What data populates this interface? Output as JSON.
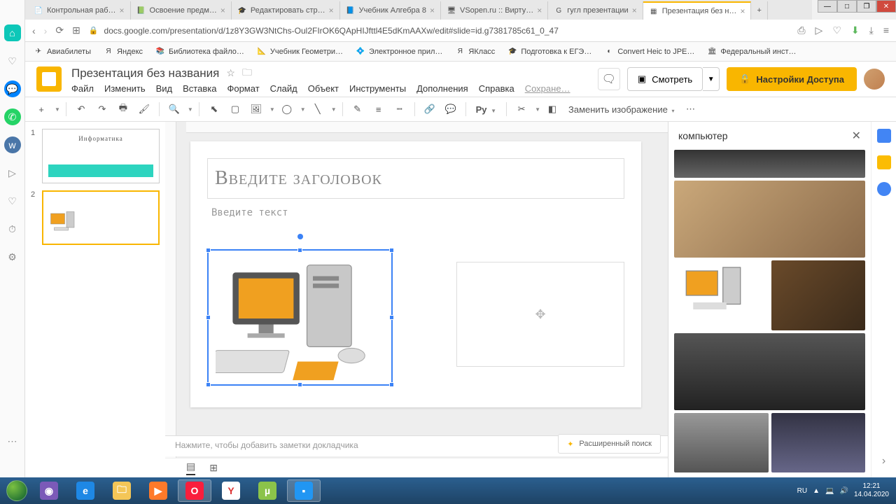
{
  "tabs": [
    {
      "title": "Контрольная раб…",
      "fav": "📄"
    },
    {
      "title": "Освоение предм…",
      "fav": "📗"
    },
    {
      "title": "Редактировать стр…",
      "fav": "🎓"
    },
    {
      "title": "Учебник Алгебра 8",
      "fav": "📘"
    },
    {
      "title": "VSopen.ru :: Вирту…",
      "fav": "🖥"
    },
    {
      "title": "гугл презентации",
      "fav": "G"
    },
    {
      "title": "Презентация без н…",
      "fav": "▦",
      "active": true
    }
  ],
  "url": "docs.google.com/presentation/d/1z8Y3GW3NtChs-Oul2FIrOK6QApHIJfttl4E5dKmAAXw/edit#slide=id.g7381785c61_0_47",
  "bookmarks": [
    {
      "label": "Авиабилеты",
      "icon": "✈"
    },
    {
      "label": "Яндекс",
      "icon": "Я"
    },
    {
      "label": "Библиотека файло…",
      "icon": "📚"
    },
    {
      "label": "Учебник Геометри…",
      "icon": "📐"
    },
    {
      "label": "Электронное прил…",
      "icon": "💠"
    },
    {
      "label": "ЯКласс",
      "icon": "Я"
    },
    {
      "label": "Подготовка к ЕГЭ…",
      "icon": "🎓"
    },
    {
      "label": "Convert Heic to JPE…",
      "icon": "◐"
    },
    {
      "label": "Федеральный инст…",
      "icon": "🏛"
    }
  ],
  "doc": {
    "title": "Презентация без названия",
    "saving": "Сохране…"
  },
  "menu": [
    "Файл",
    "Изменить",
    "Вид",
    "Вставка",
    "Формат",
    "Слайд",
    "Объект",
    "Инструменты",
    "Дополнения",
    "Справка"
  ],
  "buttons": {
    "present": "Смотреть",
    "share": "Настройки Доступа"
  },
  "toolbar": {
    "replace": "Заменить изображение"
  },
  "slide": {
    "title_ph": "Введите заголовок",
    "text_ph": "Введите текст",
    "thumb1_title": "Информатика"
  },
  "notes": "Нажмите, чтобы добавить заметки докладчика",
  "explore": {
    "term": "компьютер",
    "adv": "Расширенный поиск"
  },
  "tray": {
    "lang": "RU",
    "time": "12:21",
    "date": "14.04.2020"
  }
}
